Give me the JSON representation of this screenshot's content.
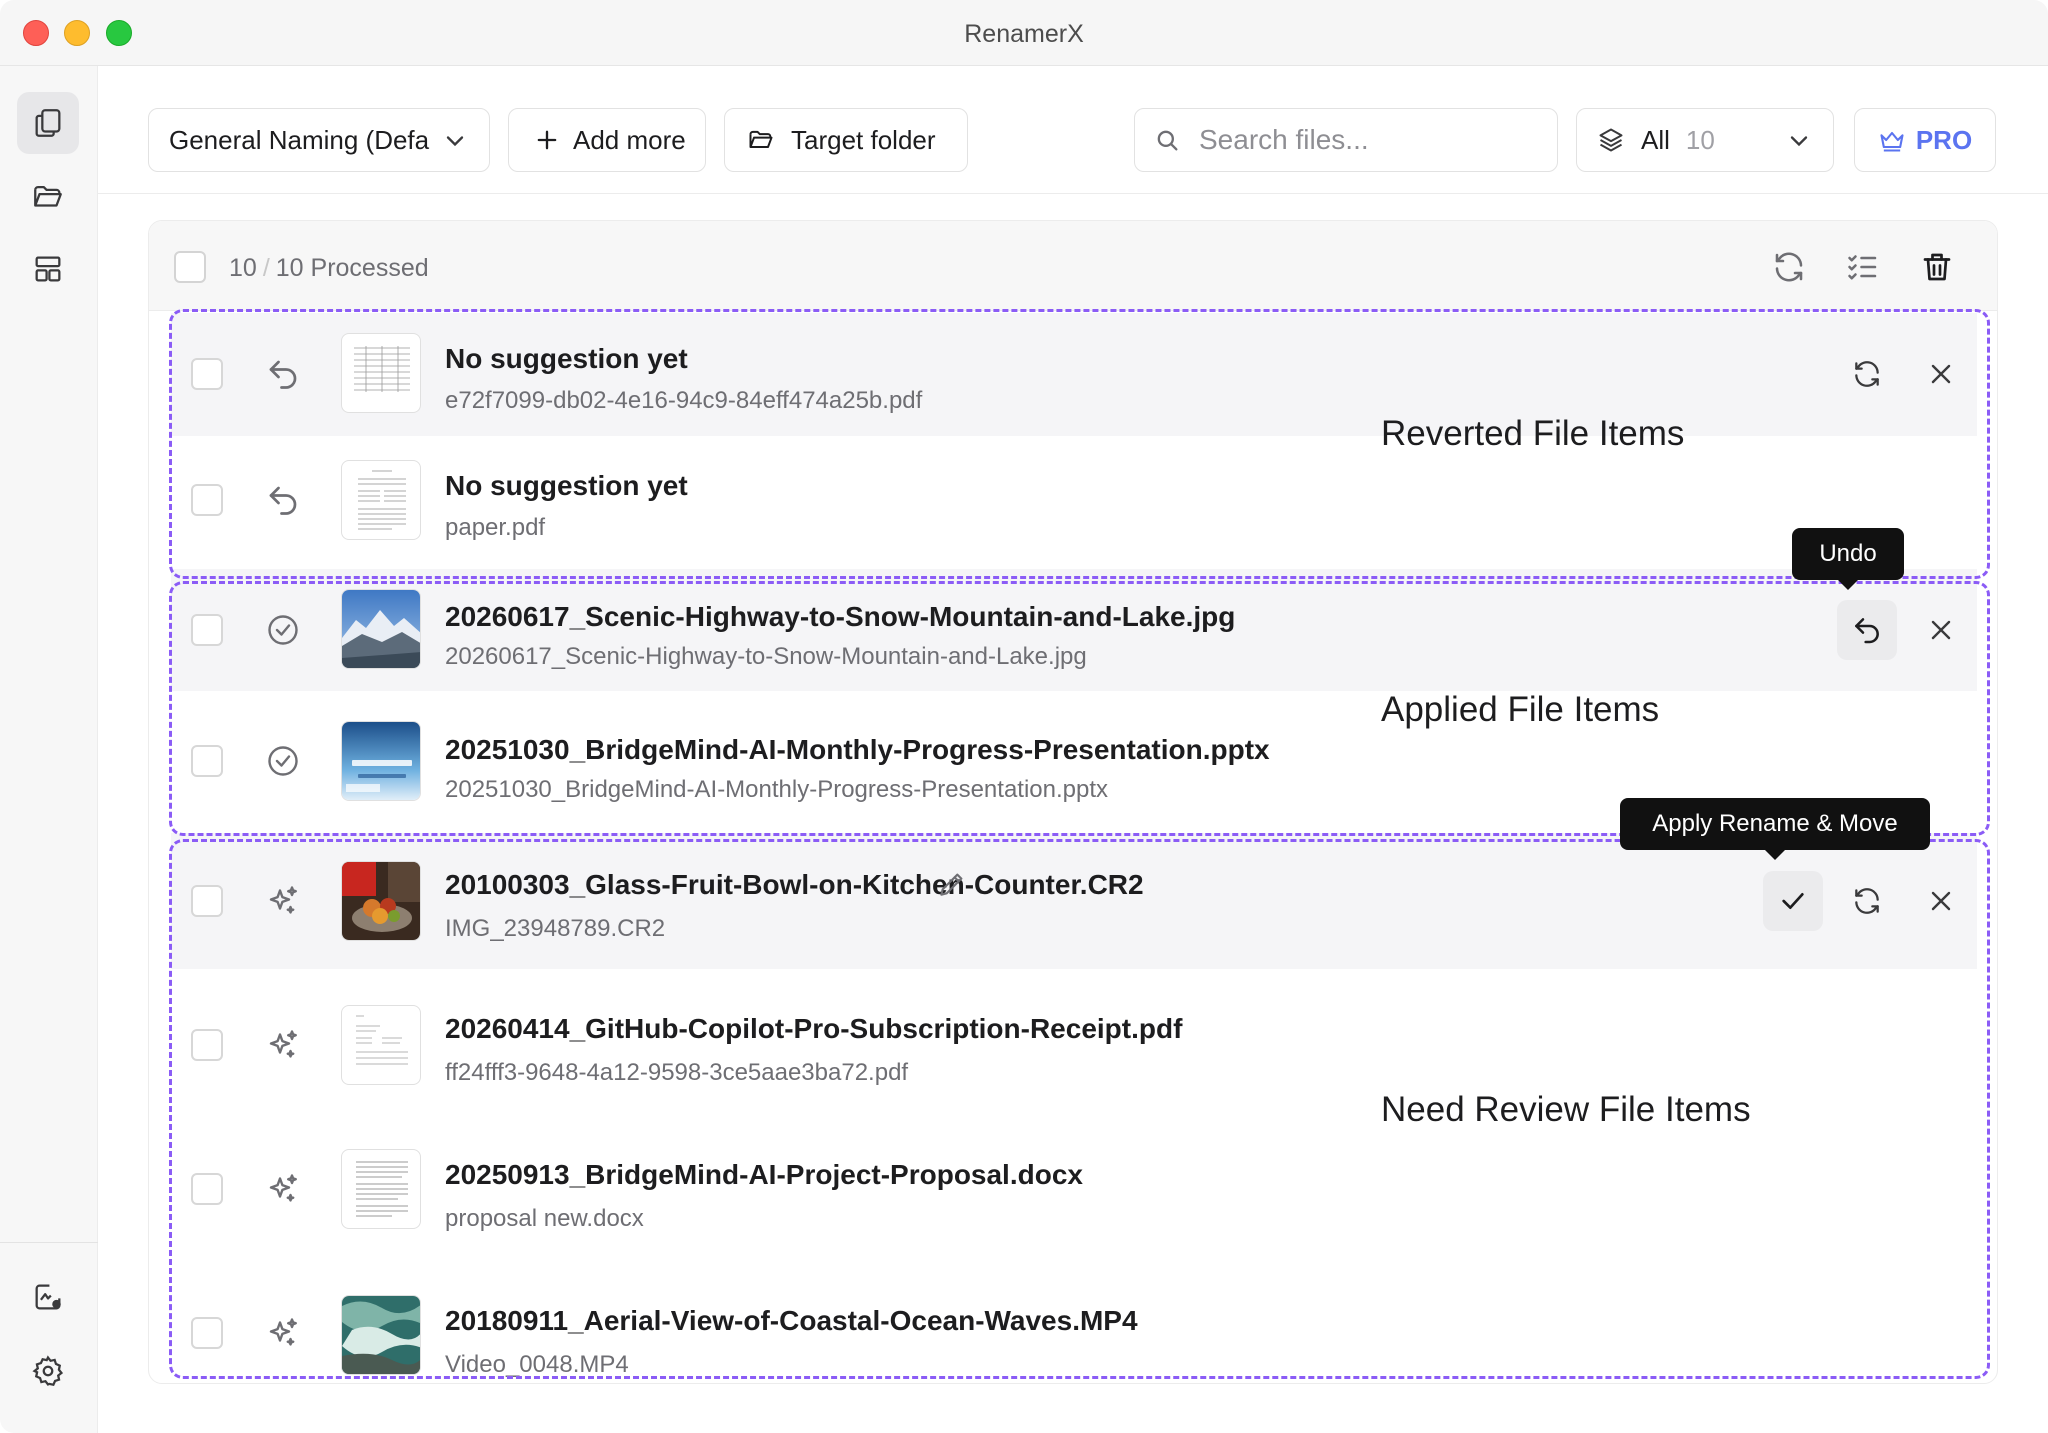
{
  "window": {
    "title": "RenamerX"
  },
  "sidebar": {
    "items": [
      {
        "name": "files-icon",
        "active": true
      },
      {
        "name": "folder-icon",
        "active": false
      },
      {
        "name": "layout-icon",
        "active": false
      }
    ],
    "bottom": [
      {
        "name": "image-activity-icon"
      },
      {
        "name": "settings-icon"
      }
    ]
  },
  "toolbar": {
    "profile_label": "General Naming (Defa",
    "add_more_label": "Add more",
    "target_folder_label": "Target folder",
    "search_placeholder": "Search files...",
    "filter_label": "All",
    "filter_count": "10",
    "pro_label": "PRO"
  },
  "list": {
    "selected_count": "10",
    "processed_label": "10 Processed",
    "rows": [
      {
        "title": "No suggestion yet",
        "original": "e72f7099-db02-4e16-94c9-84eff474a25b.pdf",
        "status": "reverted"
      },
      {
        "title": "No suggestion yet",
        "original": "paper.pdf",
        "status": "reverted"
      },
      {
        "title": "20260617_Scenic-Highway-to-Snow-Mountain-and-Lake.jpg",
        "original": "20260617_Scenic-Highway-to-Snow-Mountain-and-Lake.jpg",
        "status": "applied"
      },
      {
        "title": "20251030_BridgeMind-AI-Monthly-Progress-Presentation.pptx",
        "original": "20251030_BridgeMind-AI-Monthly-Progress-Presentation.pptx",
        "status": "applied"
      },
      {
        "title": "20100303_Glass-Fruit-Bowl-on-Kitchen-Counter.CR2",
        "original": "IMG_23948789.CR2",
        "status": "needs-review"
      },
      {
        "title": "20260414_GitHub-Copilot-Pro-Subscription-Receipt.pdf",
        "original": "ff24fff3-9648-4a12-9598-3ce5aae3ba72.pdf",
        "status": "needs-review"
      },
      {
        "title": "20250913_BridgeMind-AI-Project-Proposal.docx",
        "original": "proposal new.docx",
        "status": "needs-review"
      },
      {
        "title": "20180911_Aerial-View-of-Coastal-Ocean-Waves.MP4",
        "original": "Video_0048.MP4",
        "status": "needs-review"
      }
    ]
  },
  "annotations": {
    "reverted": "Reverted File Items",
    "applied": "Applied File Items",
    "review": "Need Review File Items"
  },
  "tooltips": {
    "undo": "Undo",
    "apply": "Apply Rename & Move"
  },
  "colors": {
    "accent": "#8b5cf6",
    "pro": "#5b74f0",
    "tooltip_bg": "#111111",
    "traffic_red": "#fe5f57",
    "traffic_yellow": "#febc2e",
    "traffic_green": "#28c840"
  }
}
